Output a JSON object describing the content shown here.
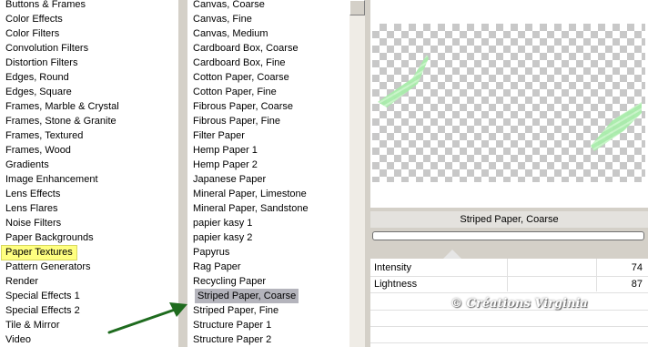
{
  "categories": [
    "Buttons & Frames",
    "Color Effects",
    "Color Filters",
    "Convolution Filters",
    "Distortion Filters",
    "Edges, Round",
    "Edges, Square",
    "Frames, Marble & Crystal",
    "Frames, Stone & Granite",
    "Frames, Textured",
    "Frames, Wood",
    "Gradients",
    "Image Enhancement",
    "Lens Effects",
    "Lens Flares",
    "Noise Filters",
    "Paper Backgrounds",
    "Paper Textures",
    "Pattern Generators",
    "Render",
    "Special Effects 1",
    "Special Effects 2",
    "Tile & Mirror",
    "Video"
  ],
  "selected_category": "Paper Textures",
  "textures": [
    "Canvas, Coarse",
    "Canvas, Fine",
    "Canvas, Medium",
    "Cardboard Box, Coarse",
    "Cardboard Box, Fine",
    "Cotton Paper, Coarse",
    "Cotton Paper, Fine",
    "Fibrous Paper, Coarse",
    "Fibrous Paper, Fine",
    "Filter Paper",
    "Hemp Paper 1",
    "Hemp Paper 2",
    "Japanese Paper",
    "Mineral Paper, Limestone",
    "Mineral Paper, Sandstone",
    "papier kasy 1",
    "papier kasy 2",
    "Papyrus",
    "Rag Paper",
    "Recycling Paper",
    "Striped Paper, Coarse",
    "Striped Paper, Fine",
    "Structure Paper 1",
    "Structure Paper 2"
  ],
  "selected_texture": "Striped Paper, Coarse",
  "preview": {
    "texture_name": "Striped Paper, Coarse"
  },
  "params": [
    {
      "label": "Intensity",
      "value": "74"
    },
    {
      "label": "Lightness",
      "value": "87"
    }
  ],
  "watermark": "© Créations Virginia",
  "colors": {
    "highlight_yellow": "#ffff80",
    "highlight_gray": "#b4b4bc",
    "arrow_green": "#1e6b1e",
    "leaf_green": "#9ee69e"
  }
}
